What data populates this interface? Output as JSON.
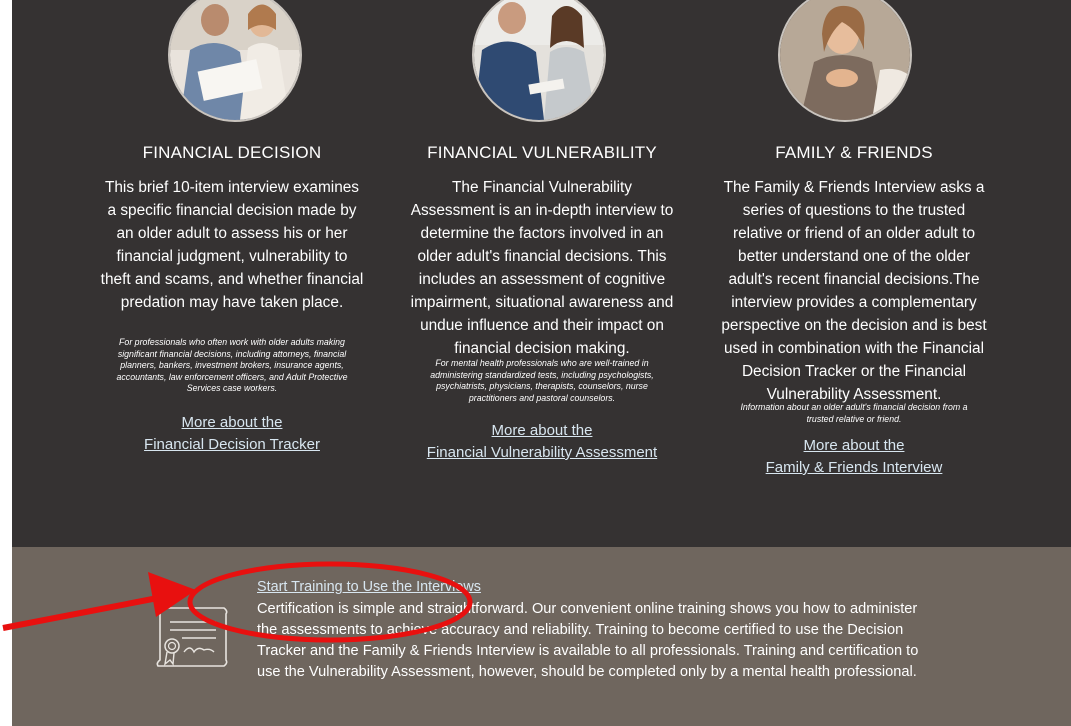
{
  "cards": [
    {
      "title": "FINANCIAL DECISION",
      "description": "This brief 10-item interview examines a specific financial decision made by an older adult to assess his or her financial judgment, vulnerability to theft and scams, and whether financial predation may have taken place.",
      "audience": "For professionals who often work with older adults making significant financial decisions, including attorneys, financial planners, bankers, investment brokers, insurance agents, accountants, law enforcement officers, and Adult Protective Services case workers.",
      "link_line1": "More about the",
      "link_line2": "Financial Decision Tracker"
    },
    {
      "title": "FINANCIAL VULNERABILITY",
      "description": "The Financial Vulnerability Assessment is an in-depth interview to determine the factors involved in an older adult's financial decisions. This includes an assessment of cognitive impairment, situational awareness and undue influence and their impact on financial decision making.",
      "audience": "For mental health professionals who are well-trained in administering standardized tests, including psychologists, psychiatrists, physicians, therapists, counselors, nurse practitioners and pastoral counselors.",
      "link_line1": "More about the",
      "link_line2": "Financial Vulnerability Assessment"
    },
    {
      "title": "FAMILY & FRIENDS",
      "description": "The Family & Friends Interview asks a series of questions to the trusted relative or friend of an older adult to better understand one of the older adult's recent financial decisions.The interview provides a complementary perspective on the decision and is best used in combination with the Financial Decision Tracker or the Financial Vulnerability Assessment.",
      "audience": "Information about an older adult's financial decision from a trusted relative or friend.",
      "link_line1": "More about the",
      "link_line2": "Family & Friends Interview"
    }
  ],
  "training": {
    "title": "Start Training to Use the Interviews",
    "text": "Certification is simple and straightforward. Our convenient online training shows you how to administer the assessments to achieve accuracy and reliability. Training to become certified to use the Decision Tracker and the Family & Friends Interview is available to all professionals. Training and certification to use the Vulnerability Assessment, however, should be completed only by a mental health professional.",
    "icon": "certificate-icon"
  },
  "colors": {
    "dark_section": "#353232",
    "training_section": "#6f665e",
    "link": "#d8e6f0",
    "annotation": "#e8100f"
  }
}
